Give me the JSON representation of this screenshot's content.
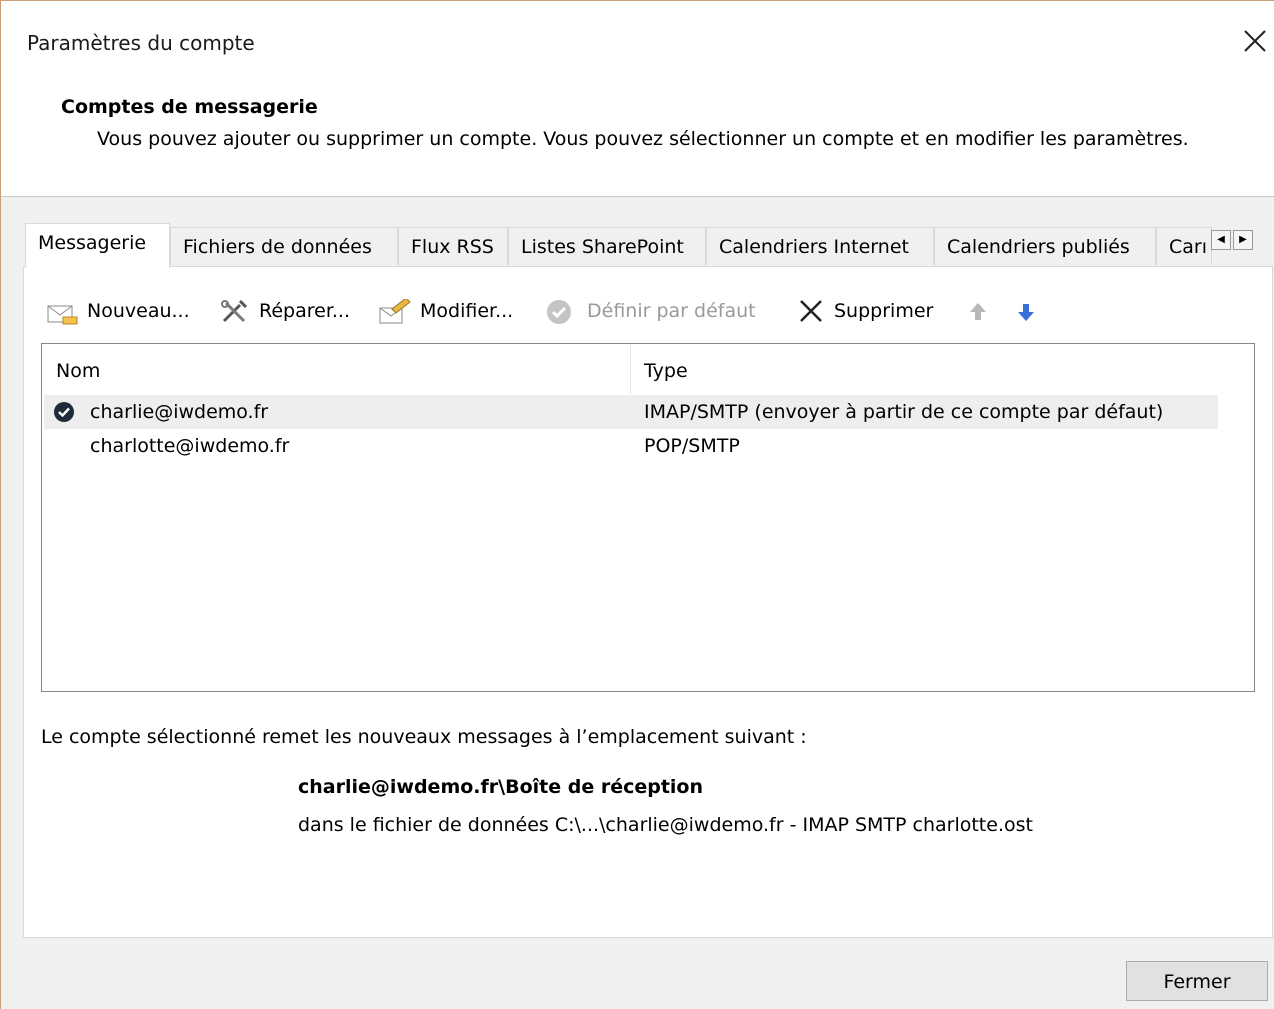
{
  "window": {
    "title": "Paramètres du compte"
  },
  "header": {
    "heading": "Comptes de messagerie",
    "description": "Vous pouvez ajouter ou supprimer un compte. Vous pouvez sélectionner un compte et en modifier les paramètres."
  },
  "tabs": [
    {
      "label": "Messagerie",
      "active": true
    },
    {
      "label": "Fichiers de données"
    },
    {
      "label": "Flux RSS"
    },
    {
      "label": "Listes SharePoint"
    },
    {
      "label": "Calendriers Internet"
    },
    {
      "label": "Calendriers publiés"
    },
    {
      "label": "Carı"
    }
  ],
  "toolbar": {
    "new_label": "Nouveau...",
    "repair_label": "Réparer...",
    "modify_label": "Modifier...",
    "set_default_label": "Définir par défaut",
    "delete_label": "Supprimer"
  },
  "list": {
    "columns": {
      "name": "Nom",
      "type": "Type"
    },
    "rows": [
      {
        "name": "charlie@iwdemo.fr",
        "type": "IMAP/SMTP (envoyer à partir de ce compte par défaut)",
        "default": true
      },
      {
        "name": "charlotte@iwdemo.fr",
        "type": "POP/SMTP"
      }
    ]
  },
  "delivery": {
    "intro": "Le compte sélectionné remet les nouveaux messages à l’emplacement suivant :",
    "folder": "charlie@iwdemo.fr\\Boîte de réception",
    "file": "dans le fichier de données C:\\...\\charlie@iwdemo.fr - IMAP SMTP charlotte.ost"
  },
  "footer": {
    "close_label": "Fermer"
  },
  "colors": {
    "accent_arrow": "#3a6fd8",
    "disabled_text": "#9a9a9a",
    "selected_row": "#eeeeee"
  }
}
